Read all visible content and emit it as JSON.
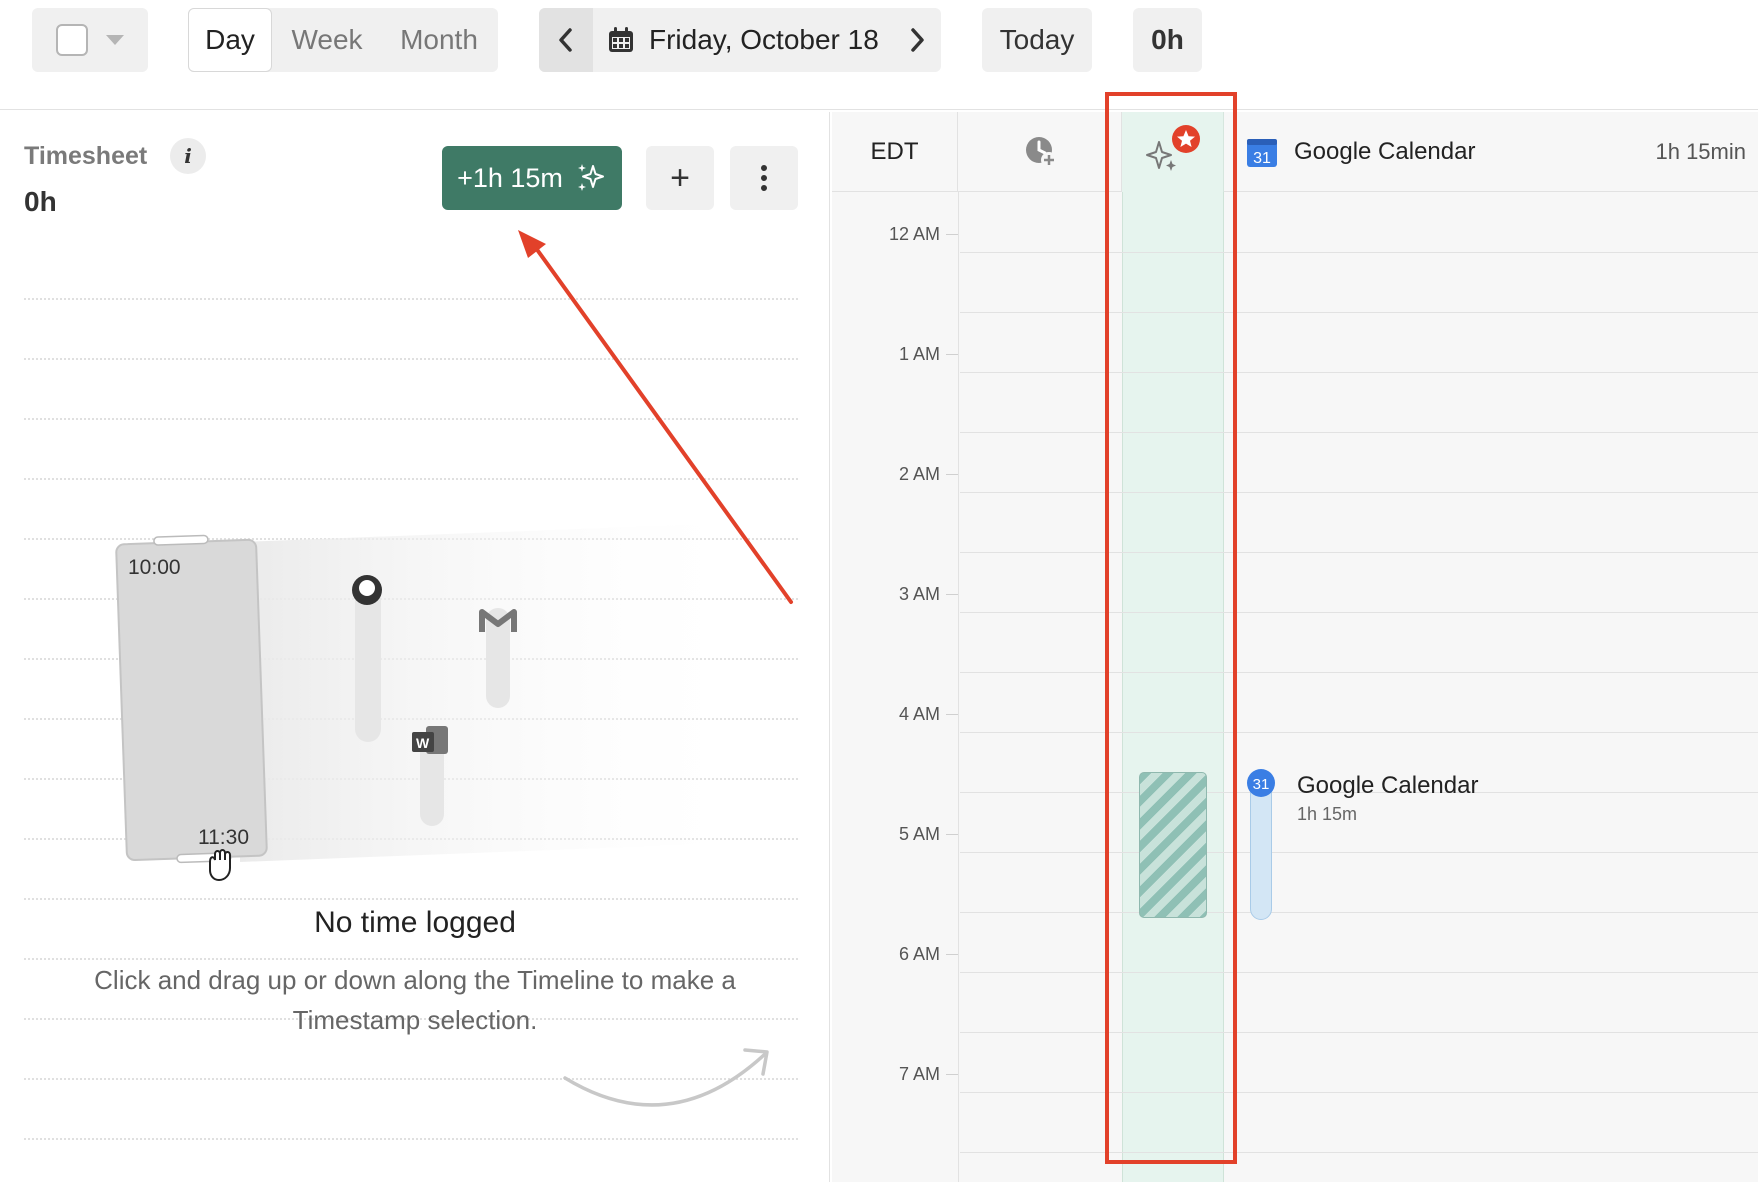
{
  "toolbar": {
    "views": [
      "Day",
      "Week",
      "Month"
    ],
    "active_view": "Day",
    "date_label": "Friday, October 18",
    "today_label": "Today",
    "hours_total": "0h"
  },
  "timesheet": {
    "title": "Timesheet",
    "info_glyph": "i",
    "total": "0h",
    "suggest_label": "+1h 15m",
    "add_glyph": "+",
    "illustration": {
      "start_time": "10:00",
      "end_time": "11:30",
      "app_icons": [
        "github-icon",
        "gmail-icon",
        "word-icon"
      ],
      "word_letter": "W"
    },
    "empty_title": "No time logged",
    "empty_desc": "Click and drag up or down along the Timeline to make a Timestamp selection."
  },
  "calendar": {
    "timezone": "EDT",
    "source_name": "Google Calendar",
    "source_duration": "1h 15min",
    "hours": [
      "12 AM",
      "1 AM",
      "2 AM",
      "3 AM",
      "4 AM",
      "5 AM",
      "6 AM",
      "7 AM"
    ],
    "event": {
      "title": "Google Calendar",
      "duration": "1h 15m",
      "badge": "31"
    },
    "gc_badge": "31"
  },
  "colors": {
    "accent_green": "#3f7a66",
    "ai_column": "#e6f4ee",
    "annotation_red": "#e2412a",
    "event_blue": "#d3e6f5",
    "gc_blue": "#3a7ee4"
  }
}
